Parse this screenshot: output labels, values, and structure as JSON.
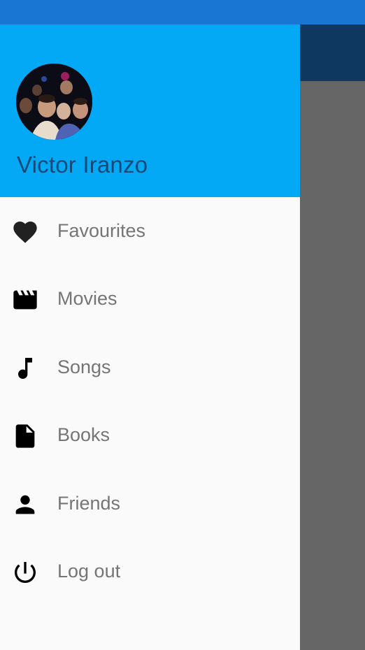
{
  "colors": {
    "status_bar": "#1976d2",
    "app_bar": "#0e385f",
    "header": "#03a9f4",
    "drawer_bg": "#fafafa",
    "scrim": "#666666",
    "user_name": "#114a78",
    "menu_label": "#757575",
    "icon": "#000000"
  },
  "header": {
    "avatar_icon": "user-photo",
    "user_name": "Victor Iranzo"
  },
  "menu": {
    "items": [
      {
        "label": "Favourites",
        "icon": "heart-icon"
      },
      {
        "label": "Movies",
        "icon": "clapperboard-icon"
      },
      {
        "label": "Songs",
        "icon": "music-note-icon"
      },
      {
        "label": "Books",
        "icon": "document-icon"
      },
      {
        "label": "Friends",
        "icon": "person-icon"
      },
      {
        "label": "Log out",
        "icon": "power-icon"
      }
    ]
  }
}
